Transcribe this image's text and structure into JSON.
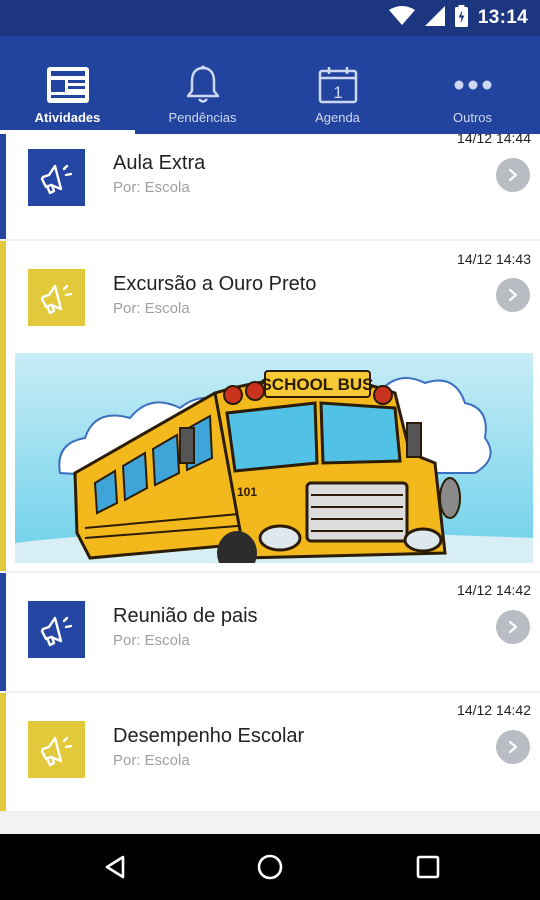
{
  "status_bar": {
    "time": "13:14",
    "icons": [
      "wifi-icon",
      "cell-signal-icon",
      "battery-charging-icon"
    ]
  },
  "tabs": [
    {
      "label": "Atividades",
      "icon": "newspaper-icon",
      "active": true
    },
    {
      "label": "Pendências",
      "icon": "bell-icon",
      "active": false
    },
    {
      "label": "Agenda",
      "icon": "calendar-icon",
      "active": false,
      "icon_text": "1"
    },
    {
      "label": "Outros",
      "icon": "more-dots-icon",
      "active": false
    }
  ],
  "feed": [
    {
      "title": "Aula Extra",
      "subtitle": "Por: Escola",
      "time": "14/12 14:44",
      "accent": "#2546a3"
    },
    {
      "title": "Excursão a Ouro Preto",
      "subtitle": "Por: Escola",
      "time": "14/12 14:43",
      "accent": "#e2c93b",
      "image": {
        "sign_text": "SCHOOL BUS",
        "unit_number": "101"
      }
    },
    {
      "title": "Reunião de pais",
      "subtitle": "Por: Escola",
      "time": "14/12 14:42",
      "accent": "#2546a3"
    },
    {
      "title": "Desempenho Escolar",
      "subtitle": "Por: Escola",
      "time": "14/12 14:42",
      "accent": "#e2c93b"
    }
  ],
  "nav_bar": {
    "buttons": [
      "back-icon",
      "home-icon",
      "recents-icon"
    ]
  },
  "colors": {
    "status_bar": "#1d3680",
    "app_bar": "#23449e",
    "blue_accent": "#2546a3",
    "yellow_accent": "#e2c93b"
  }
}
